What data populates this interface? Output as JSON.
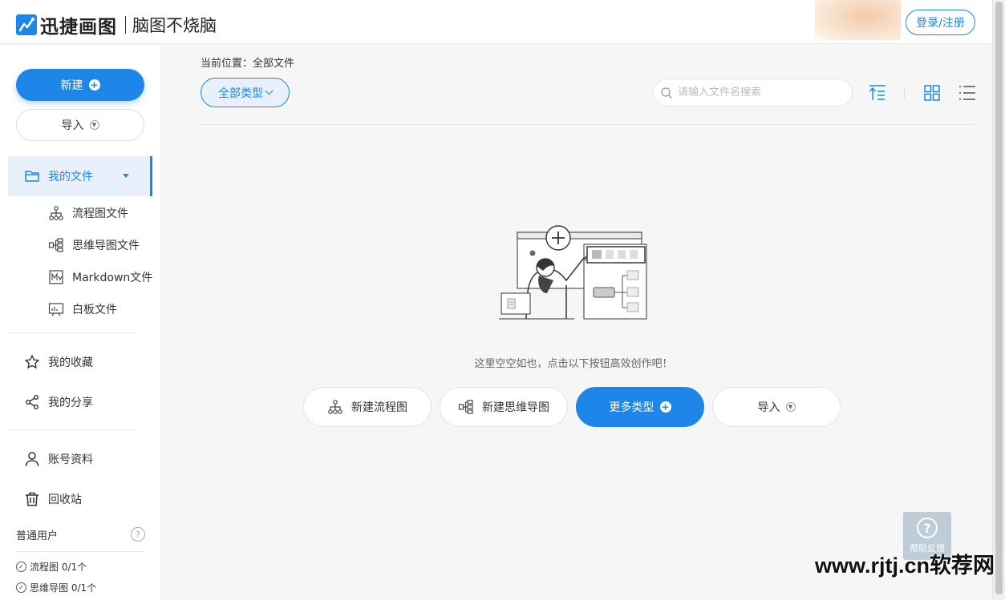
{
  "brand": {
    "name": "迅捷画图",
    "slogan": "脑图不烧脑"
  },
  "header": {
    "login_label": "登录/注册"
  },
  "sidebar": {
    "new_label": "新建",
    "import_label": "导入",
    "my_files": "我的文件",
    "sub_items": [
      "流程图文件",
      "思维导图文件",
      "Markdown文件",
      "白板文件"
    ],
    "favorites": "我的收藏",
    "shares": "我的分享",
    "account": "账号资料",
    "recycle": "回收站",
    "user_level": "普通用户",
    "quota": [
      "流程图 0/1个",
      "思维导图 0/1个"
    ]
  },
  "main": {
    "breadcrumb": "当前位置：全部文件",
    "filter_label": "全部类型",
    "search_placeholder": "请输入文件名搜索",
    "empty_text": "这里空空如也，点击以下按钮高效创作吧！",
    "actions": {
      "new_flowchart": "新建流程图",
      "new_mindmap": "新建思维导图",
      "more_types": "更多类型",
      "import": "导入"
    }
  },
  "feedback_label": "帮助反馈",
  "watermark": "www.rjtj.cn软荐网",
  "colors": {
    "accent": "#1d86e8",
    "background": "#f6f6f6"
  }
}
